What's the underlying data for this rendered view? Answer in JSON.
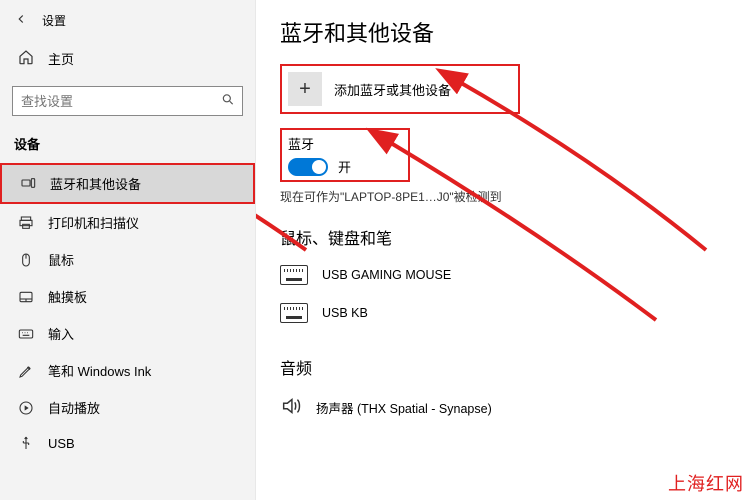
{
  "window": {
    "title": "设置"
  },
  "sidebar": {
    "home": "主页",
    "search_placeholder": "查找设置",
    "section": "设备",
    "items": [
      {
        "label": "蓝牙和其他设备"
      },
      {
        "label": "打印机和扫描仪"
      },
      {
        "label": "鼠标"
      },
      {
        "label": "触摸板"
      },
      {
        "label": "输入"
      },
      {
        "label": "笔和 Windows Ink"
      },
      {
        "label": "自动播放"
      },
      {
        "label": "USB"
      }
    ]
  },
  "page": {
    "title": "蓝牙和其他设备",
    "add_device": "添加蓝牙或其他设备",
    "bluetooth_label": "蓝牙",
    "toggle_state": "开",
    "discoverable": "现在可作为\"LAPTOP-8PE1…J0\"被检测到",
    "cat_mouse": "鼠标、键盘和笔",
    "devices": [
      {
        "name": "USB GAMING MOUSE"
      },
      {
        "name": "USB KB"
      }
    ],
    "cat_audio": "音频",
    "audio_devices": [
      {
        "name": "扬声器 (THX Spatial - Synapse)"
      }
    ]
  },
  "annotation": {
    "watermark": "上海红网"
  },
  "colors": {
    "accent": "#0078d7",
    "highlight": "#e02020"
  }
}
